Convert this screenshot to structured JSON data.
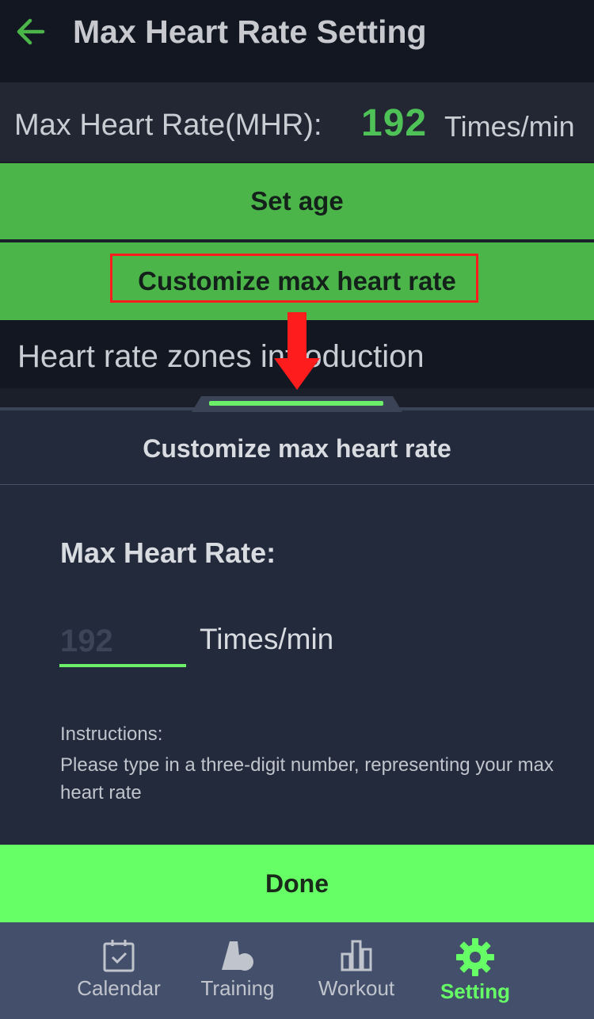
{
  "header": {
    "title": "Max Heart Rate Setting"
  },
  "mhr": {
    "label": "Max Heart Rate(MHR):",
    "value": "192",
    "unit": "Times/min"
  },
  "buttons": {
    "set_age": "Set age",
    "customize": "Customize max heart rate"
  },
  "zones": {
    "label": "Heart rate zones introduction"
  },
  "sheet": {
    "title": "Customize max heart rate",
    "field_label": "Max Heart Rate:",
    "input_placeholder": "192",
    "unit": "Times/min",
    "instructions_title": "Instructions:",
    "instructions_body": "Please type in a three-digit number, representing your max heart rate",
    "done_label": "Done"
  },
  "tabs": [
    {
      "label": "Calendar",
      "icon": "calendar-icon",
      "active": false
    },
    {
      "label": "Training",
      "icon": "training-icon",
      "active": false
    },
    {
      "label": "Workout",
      "icon": "workout-icon",
      "active": false
    },
    {
      "label": "Setting",
      "icon": "gear-icon",
      "active": true
    }
  ],
  "colors": {
    "accent_green": "#4cb54a",
    "bright_green": "#66ff66",
    "mhr_green": "#4fc257",
    "highlight_red": "#ff1c1c",
    "header_bg": "#131722",
    "sheet_bg": "#232a3b",
    "tabbar_bg": "#44506b"
  }
}
